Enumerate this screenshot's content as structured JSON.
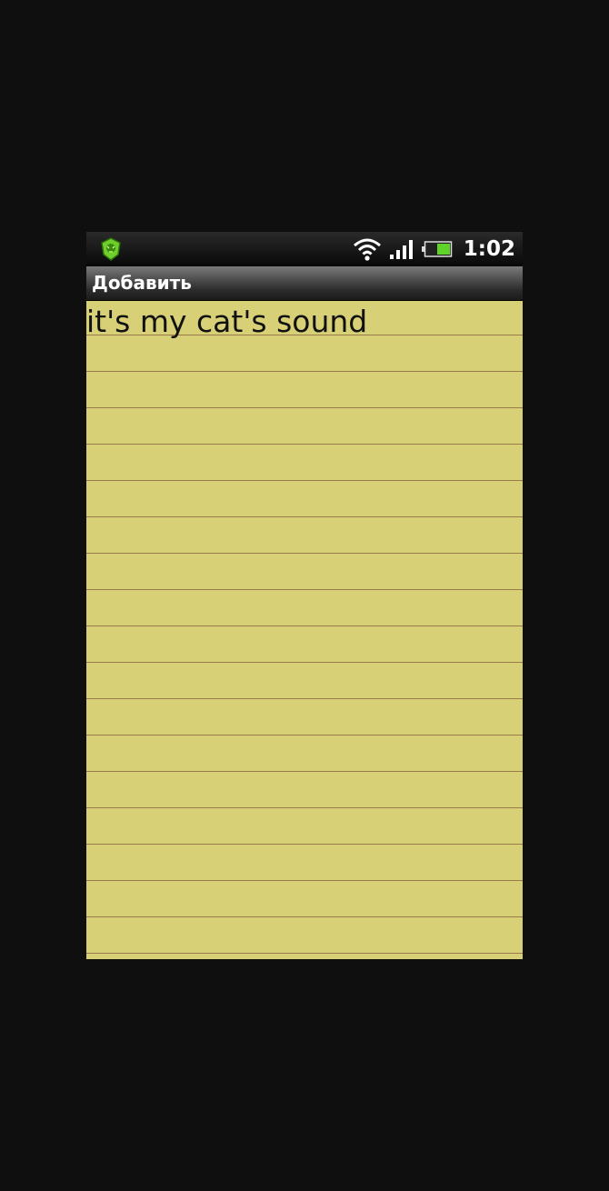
{
  "status_bar": {
    "app_icon": "lion-shield-icon",
    "wifi_icon": "wifi-icon",
    "signal_icon": "signal-bars-icon",
    "battery_icon": "battery-icon",
    "time": "1:02",
    "colors": {
      "app_icon_green": "#6fcf2a",
      "battery_fill": "#5fd32a"
    }
  },
  "title_bar": {
    "title": "Добавить"
  },
  "note": {
    "text": "it's my cat's sound",
    "paper_color": "#d8d077",
    "line_color": "#9a7a4a"
  },
  "controls": {
    "record_button": {
      "icon": "record-icon",
      "color": "#d40000"
    },
    "play_button": {
      "icon": "play-icon"
    }
  }
}
